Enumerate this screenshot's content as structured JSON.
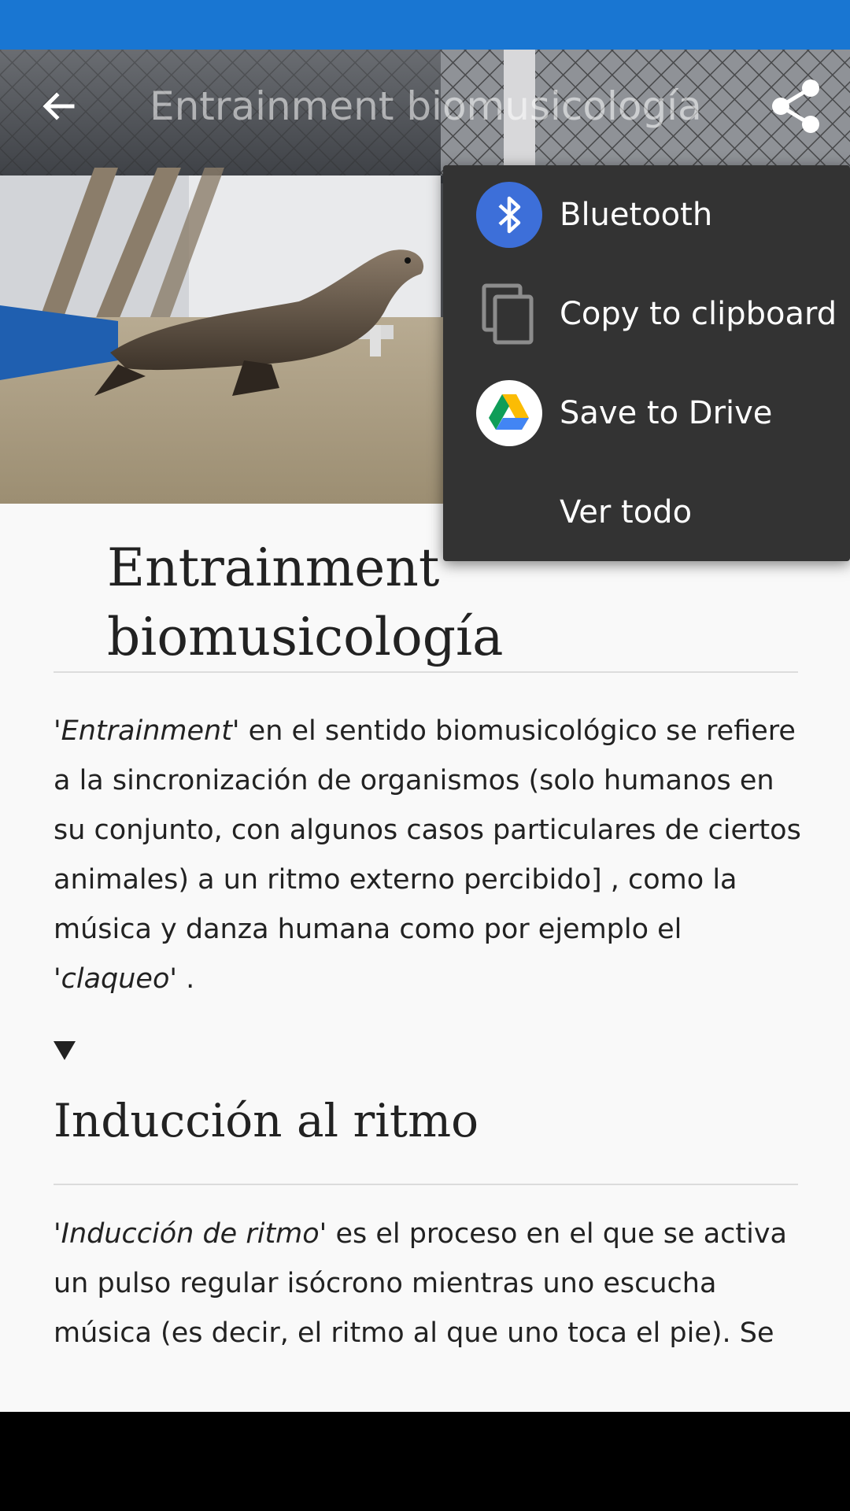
{
  "toolbar": {
    "title": "Entrainment biomusicología",
    "back_icon": "arrow-back-icon",
    "share_icon": "share-icon"
  },
  "hero_image": {
    "subject": "sea-lion-photo"
  },
  "article": {
    "title_line1": "Entrainment",
    "title_line2": "biomusicología",
    "intro": {
      "term": "'Entrainment'",
      "text": " en el sentido biomusicológico se refiere a la sincronización de organismos (solo humanos en su conjunto, con algunos casos particulares de ciertos animales) a un ritmo externo percibido] , como la música y danza humana como por ejemplo el ",
      "term2": "'claqueo'",
      "end": " ."
    },
    "collapse_icon": "triangle-down-icon",
    "section1": {
      "heading": "Inducción al ritmo",
      "term": "'Inducción de ritmo'",
      "text": " es el proceso en el que se activa un pulso regular isócrono mientras uno escucha música (es decir, el ritmo al que uno toca el pie). Se"
    }
  },
  "share_menu": {
    "items": [
      {
        "label": "Bluetooth",
        "icon": "bluetooth-icon"
      },
      {
        "label": "Copy to clipboard",
        "icon": "clipboard-icon"
      },
      {
        "label": "Save to Drive",
        "icon": "drive-icon"
      },
      {
        "label": "Ver todo",
        "icon": ""
      }
    ]
  },
  "colors": {
    "status_bar": "#1976d2",
    "menu_bg": "#333333",
    "content_bg": "#f9f9f9",
    "bluetooth_blue": "#3d6fd9"
  }
}
